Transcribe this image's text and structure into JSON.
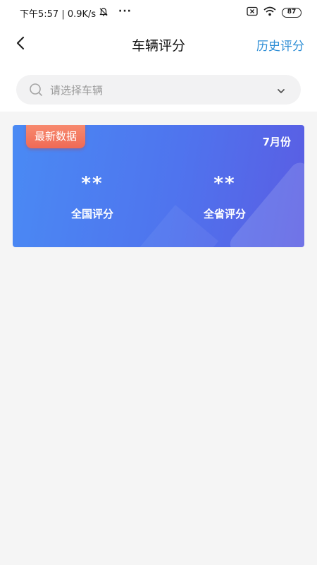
{
  "status_bar": {
    "time_speed": "下午5:57 | 0.9K/s",
    "more": "···",
    "battery": "87"
  },
  "nav": {
    "title": "车辆评分",
    "action": "历史评分"
  },
  "search": {
    "placeholder": "请选择车辆"
  },
  "card": {
    "badge": "最新数据",
    "month": "7月份",
    "national": {
      "value": "**",
      "label": "全国评分"
    },
    "provincial": {
      "value": "**",
      "label": "全省评分"
    }
  },
  "colors": {
    "accent": "#2f8fd6",
    "card_start": "#4a8af4",
    "card_end": "#5a5de3",
    "badge": "#f06a55"
  }
}
